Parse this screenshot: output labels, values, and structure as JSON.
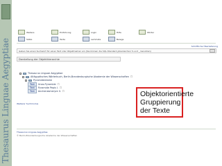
{
  "sidebar": {
    "title": "Thesaurus Linguae Aegyptiae"
  },
  "toolbar": {
    "items": [
      "Weitere",
      "Einführung",
      "Login",
      "Hilfe",
      "Wörter",
      "Sätze",
      "Texte",
      "Lemmata",
      "Belege"
    ]
  },
  "top_link": "Schriftliche Überlieferung",
  "search": {
    "text": "Geben Sie einen Suchwort für einen Text oder Objektnamen ein (Sie können die SQL-Standard-Jokerzeichen % und _ benutzen)"
  },
  "section_title": "Darstellung der Objekthierarchie",
  "tree": [
    {
      "label": "Thesaurus Linguae Aegyptiae",
      "badge": false
    },
    {
      "label": "Altägyptisches Wörterbuch, Berlin-Brandenburgische Akademie der Wissenschaften",
      "badge": false
    },
    {
      "label": "Pyramidentexte",
      "badge": false
    },
    {
      "label": "Unas-Pyramide",
      "badge": true
    },
    {
      "label": "Pyramide Pepis I.",
      "badge": true
    },
    {
      "label": "Anchenesmeryre II.",
      "badge": true
    }
  ],
  "footer_link": "Weiterer Suchmodus",
  "footer": {
    "line1": "Thesaurus Linguae Aegyptiae",
    "line2": "© Berlin-Brandenburgische Akademie der Wissenschaften"
  },
  "callout": {
    "text": "Objektorientierte Gruppierung der Texte"
  }
}
